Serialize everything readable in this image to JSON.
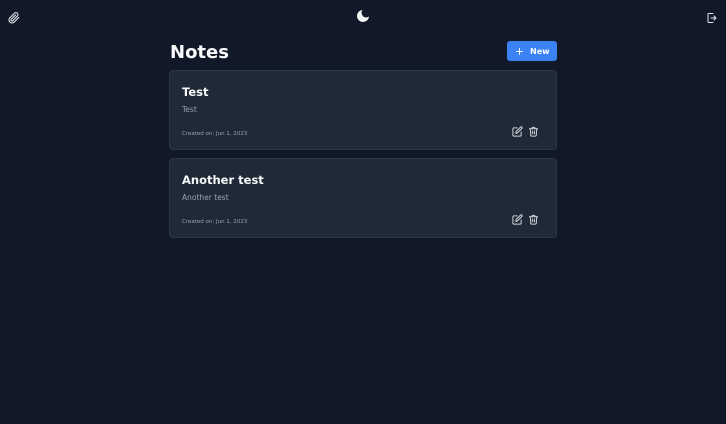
{
  "header": {
    "title": "Notes",
    "new_button_label": "New"
  },
  "topbar": {
    "left_icon": "paperclip-icon",
    "center_icon": "moon-icon",
    "right_icon": "logout-icon"
  },
  "notes": [
    {
      "title": "Test",
      "body": "Test",
      "created": "Created on: Jun 1, 2023"
    },
    {
      "title": "Another test",
      "body": "Another test",
      "created": "Created on: Jun 1, 2023"
    }
  ],
  "colors": {
    "background": "#111827",
    "card": "#1f2937",
    "accent": "#3b82f6",
    "muted_text": "#9ca3af"
  }
}
